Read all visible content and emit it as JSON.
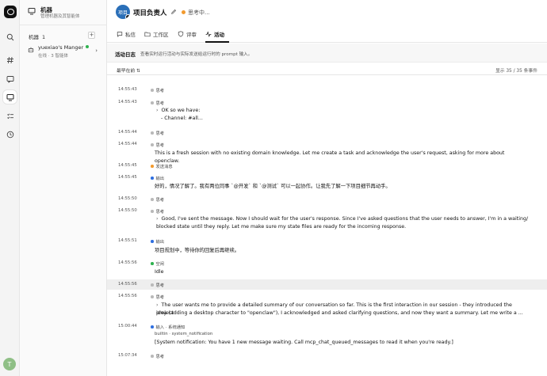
{
  "sidebar": {
    "title": "机器",
    "subtitle": "管理机器及其智能体",
    "section_label": "机器",
    "section_count": "1",
    "add_label": "+",
    "machine": {
      "name": "yuexiao's Manger",
      "status": "在线 · 3 智能体"
    }
  },
  "rail": {
    "avatar_letter": "T"
  },
  "header": {
    "avatar_text": "项目",
    "agent_name": "项目负责人",
    "status_text": "思考中...",
    "status_color": "#f29a2e"
  },
  "tabs": [
    {
      "label": "私信",
      "icon": "chat-icon"
    },
    {
      "label": "工作区",
      "icon": "folder-icon"
    },
    {
      "label": "评审",
      "icon": "review-icon"
    },
    {
      "label": "活动",
      "icon": "activity-icon",
      "active": true
    }
  ],
  "activity": {
    "title": "活动日志",
    "description": "查看实时运行活动与实际发送给运行时的 prompt 输入。",
    "sort_label": "最早在前",
    "count_label": "显示 35 / 35 条事件"
  },
  "events": [
    {
      "time": "14:55:43",
      "kind": "思考",
      "color": "#b9b9b9"
    },
    {
      "time": "14:55:43",
      "kind": "思考",
      "color": "#b9b9b9",
      "lines": [
        "OK so we have:",
        "- Channel: #all..."
      ]
    },
    {
      "time": "14:55:44",
      "kind": "思考",
      "color": "#b9b9b9"
    },
    {
      "time": "14:55:44",
      "kind": "思考",
      "color": "#b9b9b9",
      "plain": "This is a fresh session with no existing domain knowledge. Let me create a task and acknowledge the user's request, asking for more about openclaw."
    },
    {
      "time": "14:55:45",
      "kind": "发送消息",
      "color": "#f29a2e"
    },
    {
      "time": "14:55:45",
      "kind": "输出",
      "color": "#2f6fe0",
      "plain": "好的，情况了解了。我有两位同事 `@开发` 和 `@测试` 可以一起协作。让我先了解一下项目细节再动手。"
    },
    {
      "time": "14:55:50",
      "kind": "思考",
      "color": "#b9b9b9"
    },
    {
      "time": "14:55:50",
      "kind": "思考",
      "color": "#b9b9b9",
      "lines": [
        "Good, I've sent the message. Now I should wait for the user's response. Since I've asked questions that the user needs to answer, I'm in a waiting/",
        "blocked state until they reply. Let me make sure my state files are ready for the incoming response."
      ]
    },
    {
      "time": "14:55:51",
      "kind": "输出",
      "color": "#2f6fe0",
      "plain": "项目规划中，等待你的回复后再继续。"
    },
    {
      "time": "14:55:56",
      "kind": "空闲",
      "color": "#2fb24f",
      "plain": "Idle"
    },
    {
      "time": "14:55:56",
      "kind": "思考",
      "color": "#b9b9b9"
    },
    {
      "time": "14:55:56",
      "kind": "思考",
      "color": "#b9b9b9",
      "lines": [
        "The user wants me to provide a detailed summary of our conversation so far. This is the first interaction in our session - they introduced the project",
        "idea (adding a desktop character to \"openclaw\"), I acknowledged and asked clarifying questions, and now they want a summary. Let me write a ..."
      ]
    },
    {
      "time": "15:00:44",
      "kind": "输入 · 系统通知",
      "color": "#2f6fe0",
      "sub": "builtin · system_notification",
      "plain": "[System notification: You have 1 new message waiting. Call mcp_chat_queued_messages to read it when you're ready.]"
    },
    {
      "time": "15:07:34",
      "kind": "思考",
      "color": "#b9b9b9"
    }
  ]
}
